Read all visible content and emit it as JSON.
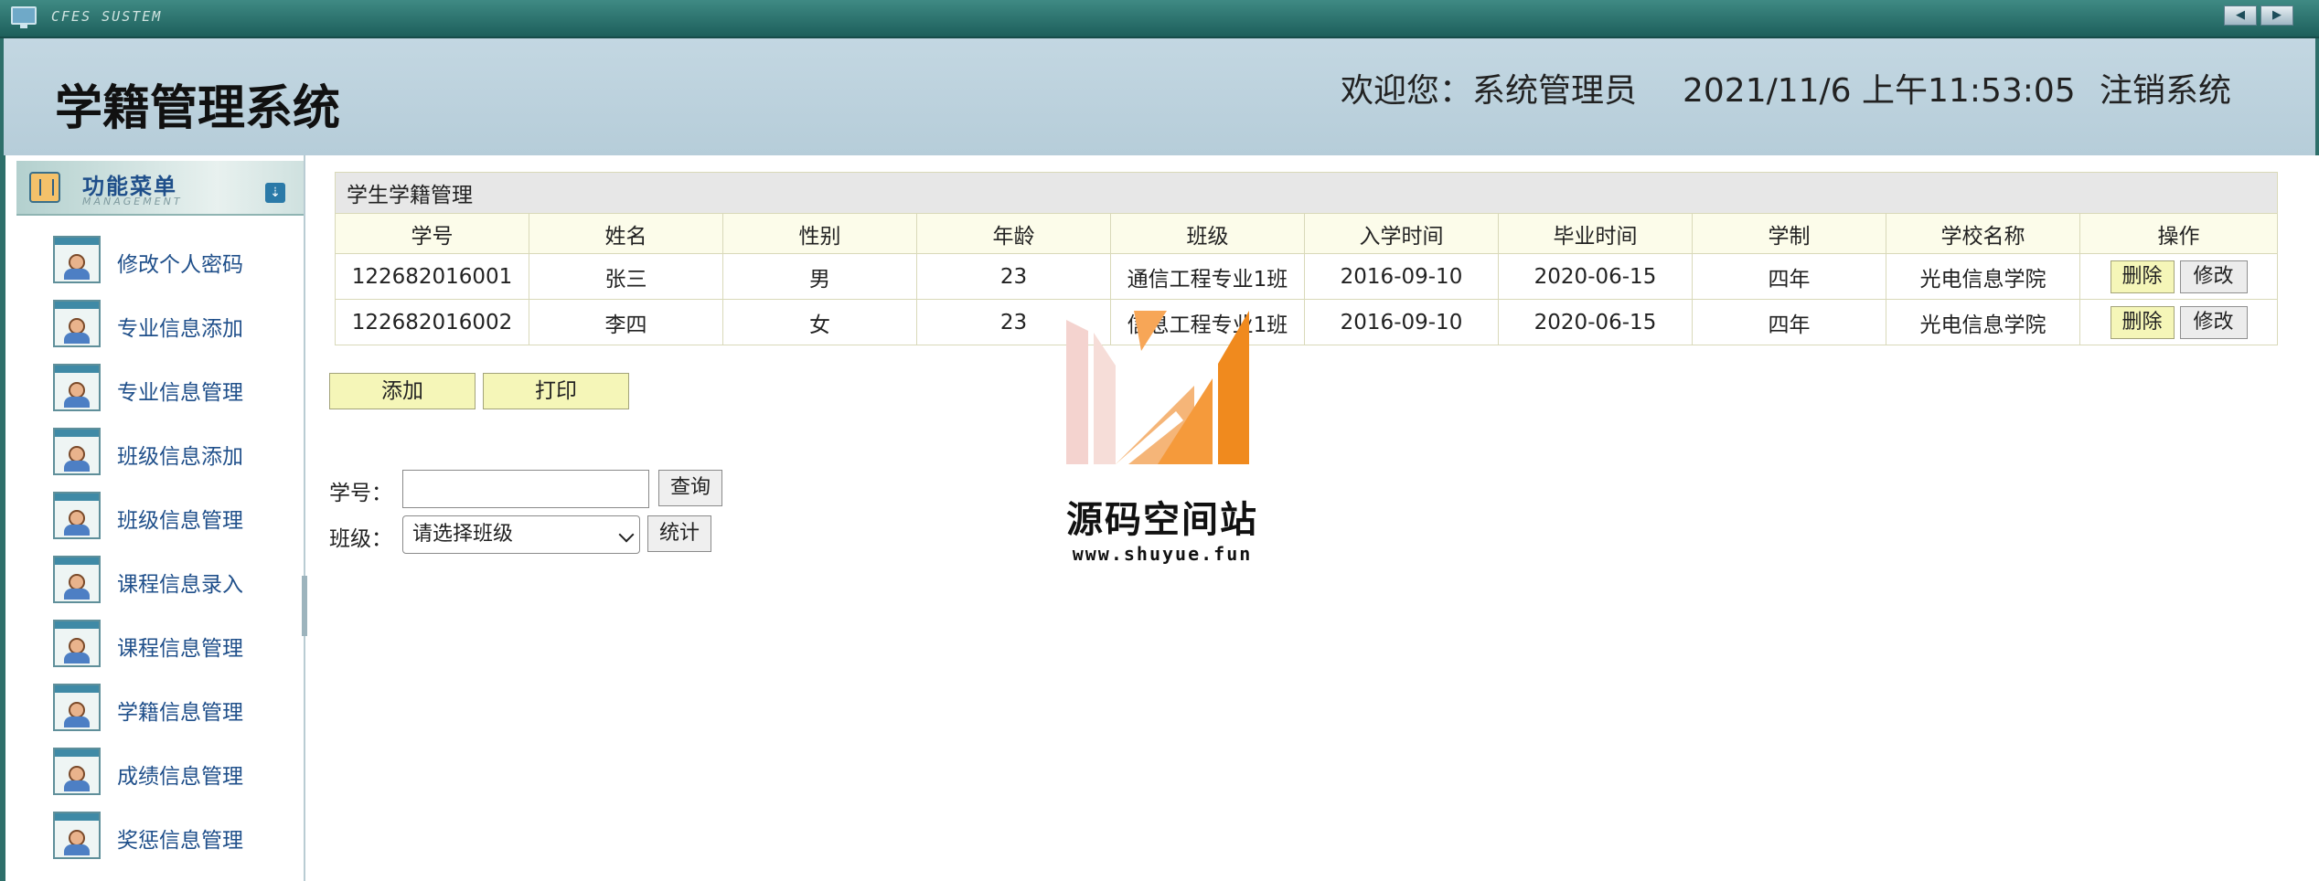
{
  "window": {
    "title": "CFES SUSTEM",
    "prev_icon": "◀",
    "next_icon": "▶"
  },
  "header": {
    "app_title": "学籍管理系统",
    "welcome": "欢迎您：系统管理员",
    "datetime": "2021/11/6 上午11:53:05",
    "logout": "注销系统"
  },
  "sidebar": {
    "title": "功能菜单",
    "subtitle": "MANAGEMENT",
    "toggle_icon": "chevrons-down-icon",
    "items": [
      {
        "label": "修改个人密码"
      },
      {
        "label": "专业信息添加"
      },
      {
        "label": "专业信息管理"
      },
      {
        "label": "班级信息添加"
      },
      {
        "label": "班级信息管理"
      },
      {
        "label": "课程信息录入"
      },
      {
        "label": "课程信息管理"
      },
      {
        "label": "学籍信息管理"
      },
      {
        "label": "成绩信息管理"
      },
      {
        "label": "奖惩信息管理"
      }
    ]
  },
  "table": {
    "caption": "学生学籍管理",
    "headers": [
      "学号",
      "姓名",
      "性别",
      "年龄",
      "班级",
      "入学时间",
      "毕业时间",
      "学制",
      "学校名称",
      "操作"
    ],
    "rows": [
      {
        "id": "122682016001",
        "name": "张三",
        "gender": "男",
        "age": "23",
        "class": "通信工程专业1班",
        "enroll": "2016-09-10",
        "graduate": "2020-06-15",
        "system": "四年",
        "school": "光电信息学院"
      },
      {
        "id": "122682016002",
        "name": "李四",
        "gender": "女",
        "age": "23",
        "class": "信息工程专业1班",
        "enroll": "2016-09-10",
        "graduate": "2020-06-15",
        "system": "四年",
        "school": "光电信息学院"
      }
    ],
    "delete_label": "删除",
    "edit_label": "修改"
  },
  "actions": {
    "add": "添加",
    "print": "打印"
  },
  "search": {
    "id_label": "学号：",
    "id_value": "",
    "query_button": "查询",
    "class_label": "班级：",
    "class_selected": "请选择班级",
    "stats_button": "统计"
  },
  "watermark": {
    "name": "源码空间站",
    "url": "www.shuyue.fun",
    "colors": {
      "pink": "#f2c9c4",
      "orange": "#f59a3b",
      "deep_orange": "#f08a1e"
    }
  }
}
